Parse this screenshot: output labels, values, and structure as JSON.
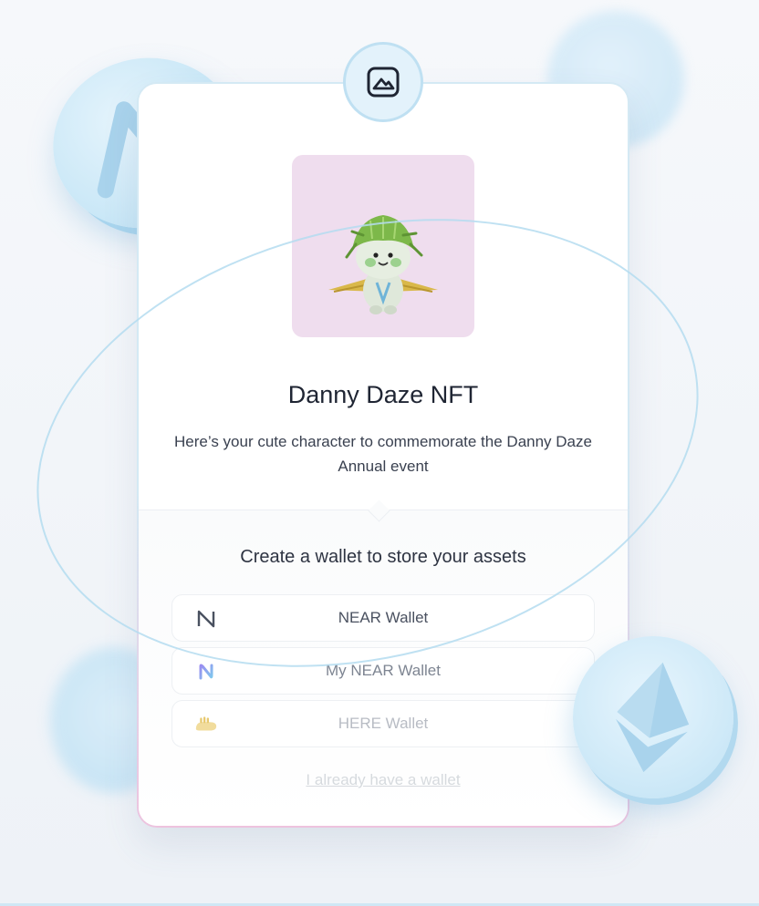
{
  "nft": {
    "title": "Danny Daze NFT",
    "description": "Here’s your cute character to commemorate the Danny Daze Annual event",
    "image_icon": "mountain-image-icon"
  },
  "wallet_section": {
    "heading": "Create a wallet to store your assets",
    "wallets": [
      {
        "label": "NEAR Wallet",
        "icon": "near-logo-icon"
      },
      {
        "label": "My NEAR Wallet",
        "icon": "my-near-wallet-icon"
      },
      {
        "label": "HERE Wallet",
        "icon": "here-wallet-icon"
      }
    ],
    "existing_wallet_link": "I already have a wallet"
  },
  "colors": {
    "accent_light_blue": "#cbe8f7",
    "image_bg": "#efddee",
    "card_border": "#d4e9f4"
  }
}
